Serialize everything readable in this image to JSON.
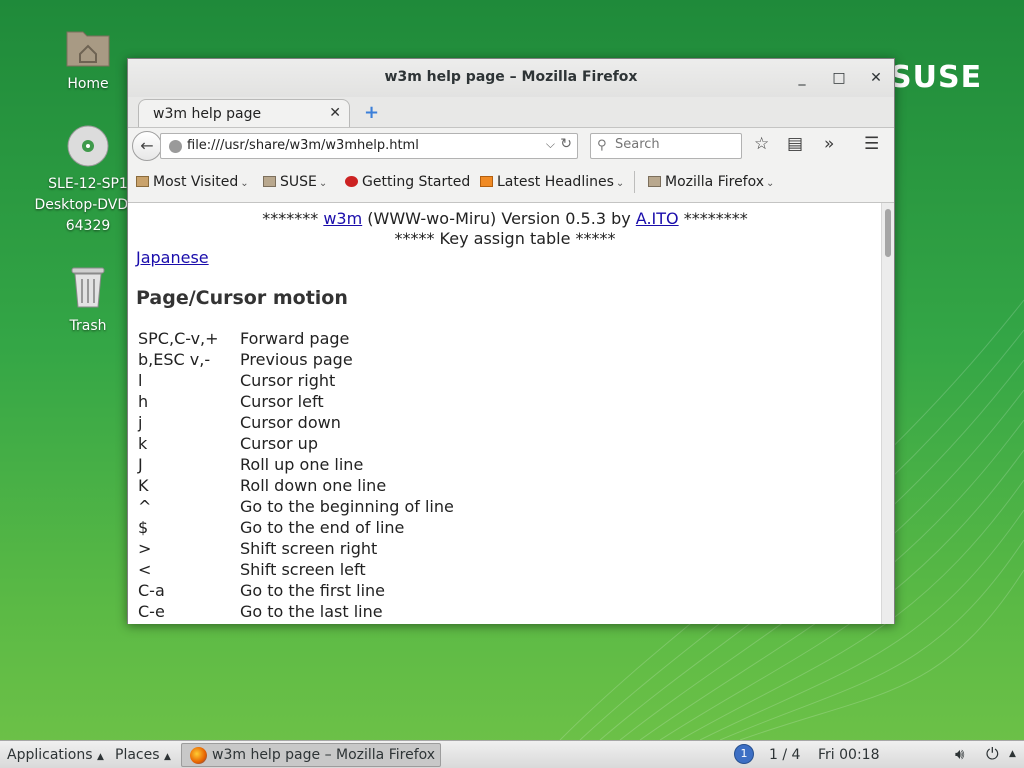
{
  "desktop": {
    "icons": [
      {
        "label": "Home"
      },
      {
        "label": "SLE-12-SP1\nDesktop-DVD-x\n64329"
      },
      {
        "label": "Trash"
      }
    ],
    "logo_text": "SUSE"
  },
  "window": {
    "title": "w3m help page – Mozilla Firefox",
    "tab_label": "w3m help page",
    "url": "file:///usr/share/w3m/w3mhelp.html",
    "search_placeholder": "Search",
    "bookmarks": [
      "Most Visited",
      "SUSE",
      "Getting Started",
      "Latest Headlines",
      "Mozilla Firefox"
    ]
  },
  "page": {
    "line1_prefix": "******* ",
    "line1_link1": "w3m",
    "line1_middle": " (WWW-wo-Miru) Version 0.5.3 by ",
    "line1_link2": "A.ITO",
    "line1_suffix": " ********",
    "line2": "***** Key assign table *****",
    "japanese_link": "Japanese",
    "section_title": "Page/Cursor motion",
    "keys": [
      {
        "key": "SPC,C-v,+",
        "action": "Forward page"
      },
      {
        "key": "b,ESC v,-",
        "action": "Previous page"
      },
      {
        "key": "l",
        "action": "Cursor right"
      },
      {
        "key": "h",
        "action": "Cursor left"
      },
      {
        "key": "j",
        "action": "Cursor down"
      },
      {
        "key": "k",
        "action": "Cursor up"
      },
      {
        "key": "J",
        "action": "Roll up one line"
      },
      {
        "key": "K",
        "action": "Roll down one line"
      },
      {
        "key": "^",
        "action": "Go to the beginning of line"
      },
      {
        "key": "$",
        "action": "Go to the end of line"
      },
      {
        "key": ">",
        "action": "Shift screen right"
      },
      {
        "key": "<",
        "action": "Shift screen left"
      },
      {
        "key": "C-a",
        "action": "Go to the first line"
      },
      {
        "key": "C-e",
        "action": "Go to the last line"
      }
    ]
  },
  "taskbar": {
    "applications": "Applications",
    "places": "Places",
    "task_label": "w3m help page – Mozilla Firefox",
    "workspace_badge": "1",
    "workspace": "1 / 4",
    "clock": "Fri 00:18"
  }
}
